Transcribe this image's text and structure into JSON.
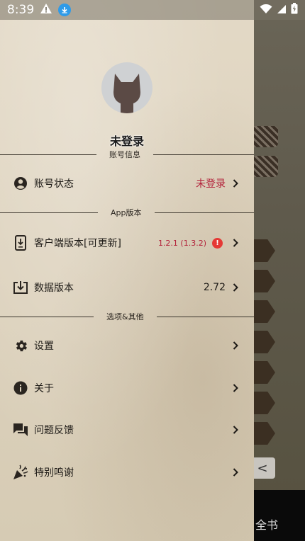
{
  "status_bar": {
    "time": "8:39",
    "icons": [
      "warning-icon",
      "download-icon",
      "wifi-icon",
      "signal-icon",
      "battery-icon"
    ]
  },
  "background": {
    "bottom_text": "全书",
    "back_glyph": "<"
  },
  "drawer": {
    "username": "未登录",
    "sections": {
      "account": {
        "title": "账号信息",
        "account_status": {
          "label": "账号状态",
          "value": "未登录",
          "value_color": "#b3233b",
          "icon": "account-circle-icon"
        }
      },
      "app_version": {
        "title": "App版本",
        "client_version": {
          "label": "客户端版本[可更新]",
          "value": "1.2.1 (1.3.2)",
          "badge": "!",
          "icon": "phone-download-icon"
        },
        "data_version": {
          "label": "数据版本",
          "value": "2.72",
          "icon": "download-box-icon"
        }
      },
      "other": {
        "title": "选项&其他",
        "settings": {
          "label": "设置",
          "icon": "gear-icon"
        },
        "about": {
          "label": "关于",
          "icon": "info-icon"
        },
        "feedback": {
          "label": "问题反馈",
          "icon": "chat-bubbles-icon"
        },
        "thanks": {
          "label": "特别鸣谢",
          "icon": "party-popper-icon"
        }
      }
    }
  },
  "colors": {
    "accent_red": "#b3233b",
    "badge_red": "#e53935",
    "drawer_bg": "#ddd2bd"
  }
}
